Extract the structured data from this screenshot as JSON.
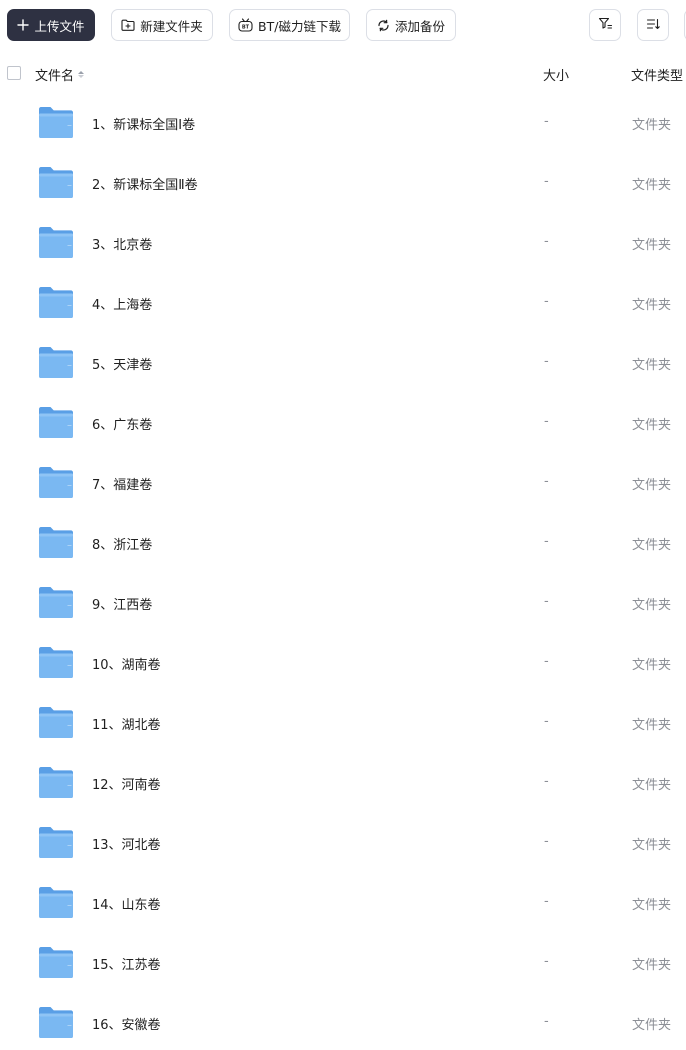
{
  "toolbar": {
    "upload_label": "上传文件",
    "new_folder_label": "新建文件夹",
    "bt_label": "BT/磁力链下载",
    "backup_label": "添加备份"
  },
  "header": {
    "name": "文件名",
    "size": "大小",
    "type": "文件类型"
  },
  "colors": {
    "primary_button": "#2e3142",
    "folder_blue": "#74b3f0",
    "muted_text": "#8c8f96"
  },
  "files": [
    {
      "name": "1、新课标全国Ⅰ卷",
      "size": "-",
      "type": "文件夹",
      "icon": "folder-icon"
    },
    {
      "name": "2、新课标全国Ⅱ卷",
      "size": "-",
      "type": "文件夹",
      "icon": "folder-icon"
    },
    {
      "name": "3、北京卷",
      "size": "-",
      "type": "文件夹",
      "icon": "folder-icon"
    },
    {
      "name": "4、上海卷",
      "size": "-",
      "type": "文件夹",
      "icon": "folder-icon"
    },
    {
      "name": "5、天津卷",
      "size": "-",
      "type": "文件夹",
      "icon": "folder-icon"
    },
    {
      "name": "6、广东卷",
      "size": "-",
      "type": "文件夹",
      "icon": "folder-icon"
    },
    {
      "name": "7、福建卷",
      "size": "-",
      "type": "文件夹",
      "icon": "folder-icon"
    },
    {
      "name": "8、浙江卷",
      "size": "-",
      "type": "文件夹",
      "icon": "folder-icon"
    },
    {
      "name": "9、江西卷",
      "size": "-",
      "type": "文件夹",
      "icon": "folder-icon"
    },
    {
      "name": "10、湖南卷",
      "size": "-",
      "type": "文件夹",
      "icon": "folder-icon"
    },
    {
      "name": "11、湖北卷",
      "size": "-",
      "type": "文件夹",
      "icon": "folder-icon"
    },
    {
      "name": "12、河南卷",
      "size": "-",
      "type": "文件夹",
      "icon": "folder-icon"
    },
    {
      "name": "13、河北卷",
      "size": "-",
      "type": "文件夹",
      "icon": "folder-icon"
    },
    {
      "name": "14、山东卷",
      "size": "-",
      "type": "文件夹",
      "icon": "folder-icon"
    },
    {
      "name": "15、江苏卷",
      "size": "-",
      "type": "文件夹",
      "icon": "folder-icon"
    },
    {
      "name": "16、安徽卷",
      "size": "-",
      "type": "文件夹",
      "icon": "folder-icon"
    }
  ]
}
